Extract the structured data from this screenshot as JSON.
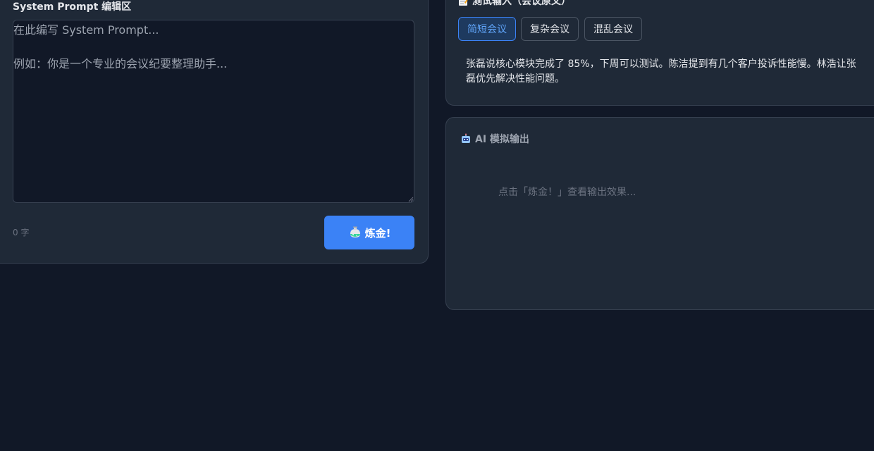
{
  "editor": {
    "title": "System Prompt 编辑区",
    "placeholder": "在此编写 System Prompt...\n\n例如：你是一个专业的会议纪要整理助手...",
    "value": "",
    "char_count": "0 字",
    "submit_label": "炼金!",
    "submit_icon": "alembic-icon"
  },
  "test_input": {
    "title": "测试输入（会议原文）",
    "title_icon": "memo-icon",
    "scenarios": [
      {
        "label": "简短会议",
        "active": true
      },
      {
        "label": "复杂会议",
        "active": false
      },
      {
        "label": "混乱会议",
        "active": false
      }
    ],
    "meeting_text": "张磊说核心模块完成了 85%，下周可以测试。陈洁提到有几个客户投诉性能慢。林浩让张磊优先解决性能问题。"
  },
  "output": {
    "title": "AI 模拟输出",
    "title_icon": "robot-icon",
    "placeholder": "点击「炼金！」查看输出效果..."
  },
  "colors": {
    "background": "#111827",
    "card": "#1f2937",
    "accent": "#3b82f6",
    "active_text": "#60a5fa"
  }
}
